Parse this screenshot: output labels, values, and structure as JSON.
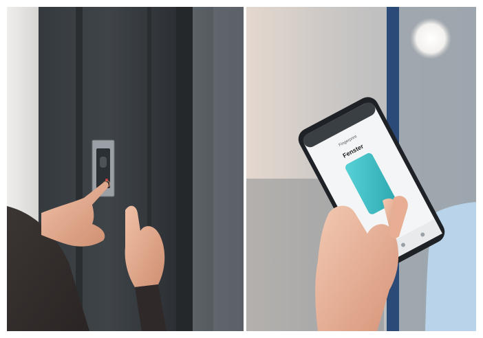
{
  "photos": [
    {
      "subject": "fingerprint-reader-door",
      "description_icon": "fingerprint-scanner-icon"
    },
    {
      "subject": "smartphone-app",
      "description_icon": "smartphone-icon",
      "phone_screen": {
        "heading": "Fingerprint",
        "subheading": "",
        "title": "Fenster"
      }
    }
  ],
  "colors": {
    "door_dark": "#2f3438",
    "door_frame": "#4a5055",
    "skin": "#e2a98c",
    "phone_body": "#1e2226",
    "phone_screen": "#f4f5f6",
    "screen_card": "#3fc3c9",
    "background_right": "#b9bec3",
    "wall_light": "#e8e6e4"
  }
}
